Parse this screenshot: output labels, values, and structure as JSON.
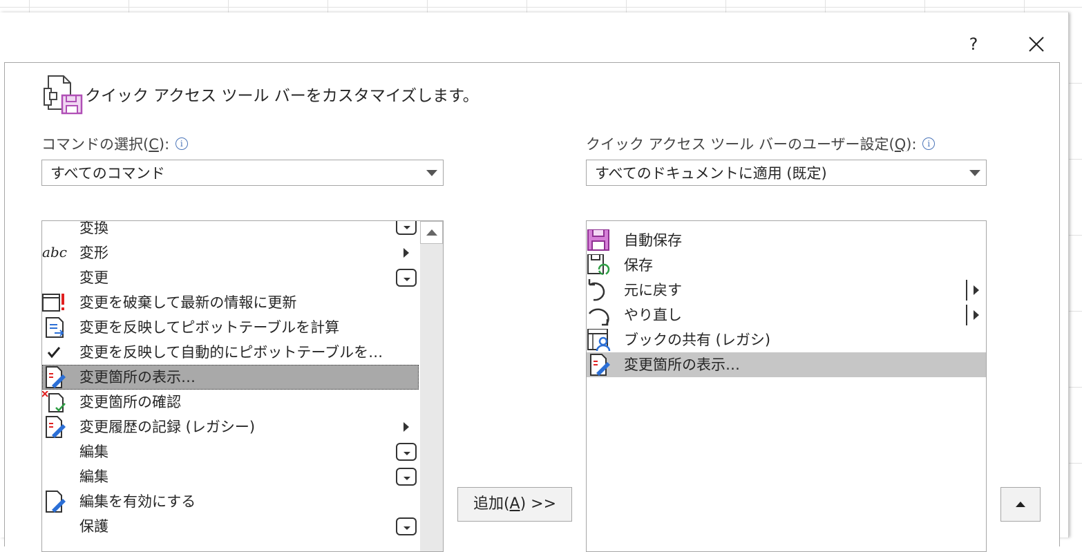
{
  "dialog": {
    "help_label": "?",
    "header_text": "クイック アクセス ツール バーをカスタマイズします。"
  },
  "left": {
    "label_pre": "コマンドの選択(",
    "label_key": "C",
    "label_post": "):",
    "select_value": "すべてのコマンド",
    "items": [
      {
        "label": "変換",
        "icon": "none"
      },
      {
        "label": "変形",
        "icon": "abc-text-icon"
      },
      {
        "label": "変更",
        "icon": "none"
      },
      {
        "label": "変更を破棄して最新の情報に更新",
        "icon": "discard-refresh-icon"
      },
      {
        "label": "変更を反映してピボットテーブルを計算",
        "icon": "pivot-calc-icon"
      },
      {
        "label": "変更を反映して自動的にピボットテーブルを…",
        "icon": "checkmark-icon"
      },
      {
        "label": "変更箇所の表示…",
        "icon": "show-changes-icon"
      },
      {
        "label": "変更箇所の確認",
        "icon": "review-changes-icon"
      },
      {
        "label": "変更履歴の記録 (レガシー)",
        "icon": "track-changes-icon"
      },
      {
        "label": "編集",
        "icon": "none"
      },
      {
        "label": "編集",
        "icon": "none"
      },
      {
        "label": "編集を有効にする",
        "icon": "enable-editing-icon"
      },
      {
        "label": "保護",
        "icon": "none"
      }
    ]
  },
  "right": {
    "label_pre": "クイック アクセス ツール バーのユーザー設定(",
    "label_key": "Q",
    "label_post": "):",
    "select_value": "すべてのドキュメントに適用 (既定)",
    "items": [
      {
        "label": "自動保存",
        "icon": "autosave-icon"
      },
      {
        "label": "保存",
        "icon": "save-icon"
      },
      {
        "label": "元に戻す",
        "icon": "undo-icon"
      },
      {
        "label": "やり直し",
        "icon": "redo-icon"
      },
      {
        "label": "ブックの共有 (レガシ)",
        "icon": "share-workbook-icon"
      },
      {
        "label": "変更箇所の表示…",
        "icon": "show-changes-icon"
      }
    ]
  },
  "add_button": {
    "pre": "追加(",
    "key": "A",
    "post": ") >>"
  },
  "colors": {
    "selected_row": "#a9a9a9",
    "selected_row_right": "#c6c6c6",
    "autosave_purple": "#c25ac5",
    "refresh_green": "#2e9e44",
    "pen_blue": "#2b6fd6",
    "alert_red": "#e02020"
  }
}
